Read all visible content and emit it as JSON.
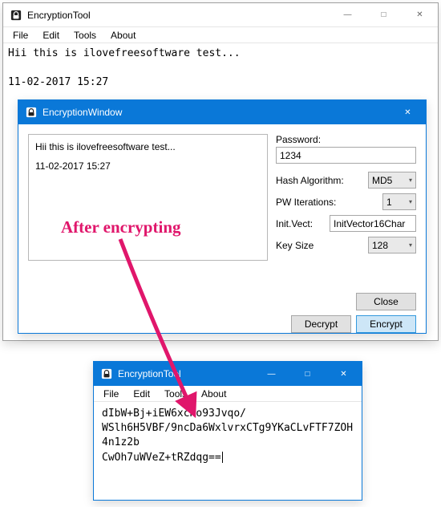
{
  "main_window": {
    "title": "EncryptionTool",
    "menu": {
      "file": "File",
      "edit": "Edit",
      "tools": "Tools",
      "about": "About"
    },
    "text_line1": "Hii this is ilovefreesoftware test...",
    "text_line2": "11-02-2017 15:27"
  },
  "enc_window": {
    "title": "EncryptionWindow",
    "plaintext_line1": "Hii this is ilovefreesoftware test...",
    "plaintext_line2": "11-02-2017 15:27",
    "password_label": "Password:",
    "password_value": "1234",
    "hash_label": "Hash Algorithm:",
    "hash_value": "MD5",
    "pw_iter_label": "PW Iterations:",
    "pw_iter_value": "1",
    "iv_label": "Init.Vect:",
    "iv_value": "InitVector16Char",
    "key_size_label": "Key Size",
    "key_size_value": "128",
    "btn_close": "Close",
    "btn_decrypt": "Decrypt",
    "btn_encrypt": "Encrypt"
  },
  "result_window": {
    "title": "EncryptionTool",
    "menu": {
      "file": "File",
      "edit": "Edit",
      "tools": "Tools",
      "about": "About"
    },
    "ciphertext": "dIbW+Bj+iEW6xcKo93Jvqo/\nWSlh6H5VBF/9ncDa6WxlvrxCTg9YKaCLvFTF7ZOH4n1z2b\nCwOh7uWVeZ+tRZdqg=="
  },
  "annotation": "After encrypting"
}
